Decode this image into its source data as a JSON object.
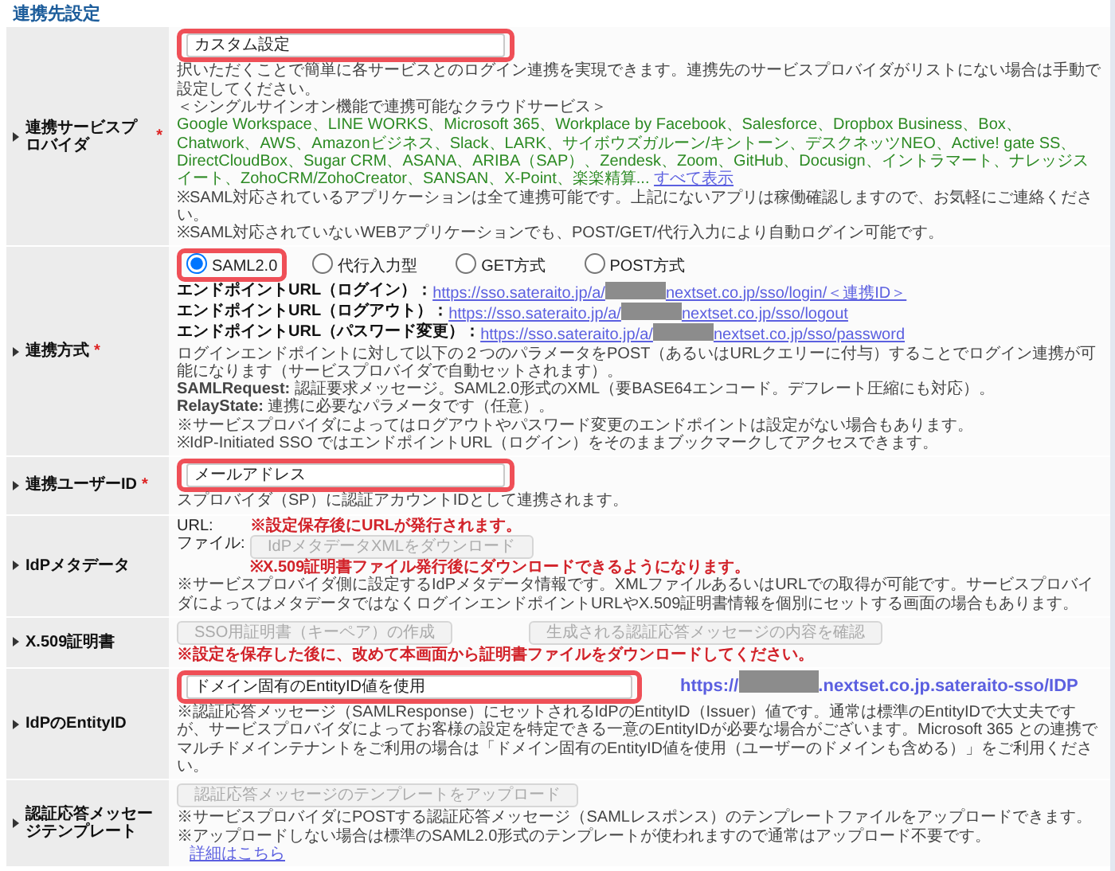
{
  "section_title": "連携先設定",
  "rows": [
    {
      "label": "連携サービスプロバイダ",
      "marker": "*",
      "items": [
        {
          "kind": "input",
          "value": "カスタム設定",
          "highlighted": true
        },
        {
          "kind": "note",
          "text": "択いただくことで簡単に各サービスとのログイン連携を実現できます。連携先のサービスプロバイダがリストにない場合は手動で設定してください。"
        },
        {
          "kind": "note",
          "text": "＜シングルサインオン機能で連携可能なクラウドサービス＞"
        },
        {
          "kind": "services",
          "text": "Google Workspace、LINE WORKS、Microsoft 365、Workplace by Facebook、Salesforce、Dropbox Business、Box、Chatwork、AWS、Amazonビジネス、Slack、LARK、サイボウズガルーン/キントーン、デスクネッツNEO、Active! gate SS、DirectCloudBox、Sugar CRM、ASANA、ARIBA（SAP）、Zendesk、Zoom、GitHub、Docusign、イントラマート、ナレッジスイート、ZohoCRM/ZohoCreator、SANSAN、X-Point、楽楽精算...",
          "link": "すべて表示"
        },
        {
          "kind": "note",
          "text": "※SAML対応されているアプリケーションは全て連携可能です。上記にないアプリは稼働確認しますので、お気軽にご連絡ください。"
        },
        {
          "kind": "note",
          "text": "※SAML対応されていないWEBアプリケーションでも、POST/GET/代行入力により自動ログイン可能です。"
        }
      ]
    },
    {
      "label": "連携方式",
      "marker": "*",
      "items": [
        {
          "kind": "radios",
          "highlighted": true,
          "options": [
            {
              "label": "SAML2.0",
              "selected": true
            },
            {
              "label": "代行入力型",
              "selected": false
            },
            {
              "label": "GET方式",
              "selected": false
            },
            {
              "label": "POST方式",
              "selected": false
            }
          ]
        },
        {
          "kind": "endpoint",
          "label": "エンドポイントURL（ログイン）：",
          "url_before": "https://sso.sateraito.jp/a/",
          "url_after": "nextset.co.jp/sso/login/＜連携ID＞"
        },
        {
          "kind": "endpoint",
          "label": "エンドポイントURL（ログアウト）：",
          "url_before": "https://sso.sateraito.jp/a/",
          "url_after": "nextset.co.jp/sso/logout"
        },
        {
          "kind": "endpoint",
          "label": "エンドポイントURL（パスワード変更）：",
          "url_before": "https://sso.sateraito.jp/a/",
          "url_after": "nextset.co.jp/sso/password"
        },
        {
          "kind": "note",
          "text": "ログインエンドポイントに対して以下の２つのパラメータをPOST（あるいはURLクエリーに付与）することでログイン連携が可能になります（サービスプロバイダで自動セットされます）。"
        },
        {
          "kind": "note",
          "text": "**SAMLRequest:** 認証要求メッセージ。SAML2.0形式のXML（要BASE64エンコード。デフレート圧縮にも対応）。"
        },
        {
          "kind": "note",
          "text": "**RelayState:** 連携に必要なパラメータです（任意）。"
        },
        {
          "kind": "note",
          "text": "※サービスプロバイダによってはログアウトやパスワード変更のエンドポイントは設定がない場合もあります。"
        },
        {
          "kind": "note",
          "text": "※IdP-Initiated SSO ではエンドポイントURL（ログイン）をそのままブックマークしてアクセスできます。"
        }
      ]
    },
    {
      "label": "連携ユーザーID",
      "marker": "*",
      "items": [
        {
          "kind": "input",
          "value": "メールアドレス",
          "highlighted": true
        },
        {
          "kind": "note",
          "text": "スプロバイダ（SP）に認証アカウントIDとして連携されます。"
        }
      ]
    },
    {
      "label": "IdPメタデータ",
      "items": [
        {
          "kind": "labeled",
          "label": "URL:",
          "notice": "※設定保存後にURLが発行されます。"
        },
        {
          "kind": "labeled",
          "label": "ファイル:",
          "button": {
            "label": "IdPメタデータXMLをダウンロード",
            "disabled": true
          },
          "notice": "※X.509証明書ファイル発行後にダウンロードできるようになります。"
        },
        {
          "kind": "note",
          "text": "※サービスプロバイダ側に設定するIdPメタデータ情報です。XMLファイルあるいはURLでの取得が可能です。サービスプロバイダによってはメタデータではなくログインエンドポイントURLやX.509証明書情報を個別にセットする画面の場合もあります。"
        }
      ]
    },
    {
      "label": "X.509証明書",
      "items": [
        {
          "kind": "buttons",
          "buttons": [
            {
              "label": "SSO用証明書（キーペア）の作成",
              "disabled": true
            },
            {
              "label": "生成される認証応答メッセージの内容を確認",
              "disabled": true
            }
          ]
        },
        {
          "kind": "notice",
          "text": "※設定を保存した後に、改めて本画面から証明書ファイルをダウンロードしてください。"
        }
      ]
    },
    {
      "label": "IdPのEntityID",
      "items": [
        {
          "kind": "input_link",
          "value": "ドメイン固有のEntityID値を使用",
          "highlighted": true,
          "url_before": "https://",
          "url_after": ".nextset.co.jp.sateraito-sso/IDP"
        },
        {
          "kind": "note",
          "text": "※認証応答メッセージ（SAMLResponse）にセットされるIdPのEntityID（Issuer）値です。通常は標準のEntityIDで大丈夫ですが、サービスプロバイダによってお客様の設定を特定できる一意のEntityIDが必要な場合がございます。Microsoft 365 との連携でマルチドメインテナントをご利用の場合は「ドメイン固有のEntityID値を使用（ユーザーのドメインも含める）」をご利用ください。"
        }
      ]
    },
    {
      "label": "認証応答メッセージテンプレート",
      "items": [
        {
          "kind": "buttons",
          "buttons": [
            {
              "label": "認証応答メッセージのテンプレートをアップロード",
              "disabled": true
            }
          ]
        },
        {
          "kind": "note",
          "text": "※サービスプロバイダにPOSTする認証応答メッセージ（SAMLレスポンス）のテンプレートファイルをアップロードできます。"
        },
        {
          "kind": "note",
          "text": "※アップロードしない場合は標準のSAML2.0形式のテンプレートが使われますので通常はアップロード不要です。",
          "link": "詳細はこちら"
        }
      ]
    }
  ]
}
